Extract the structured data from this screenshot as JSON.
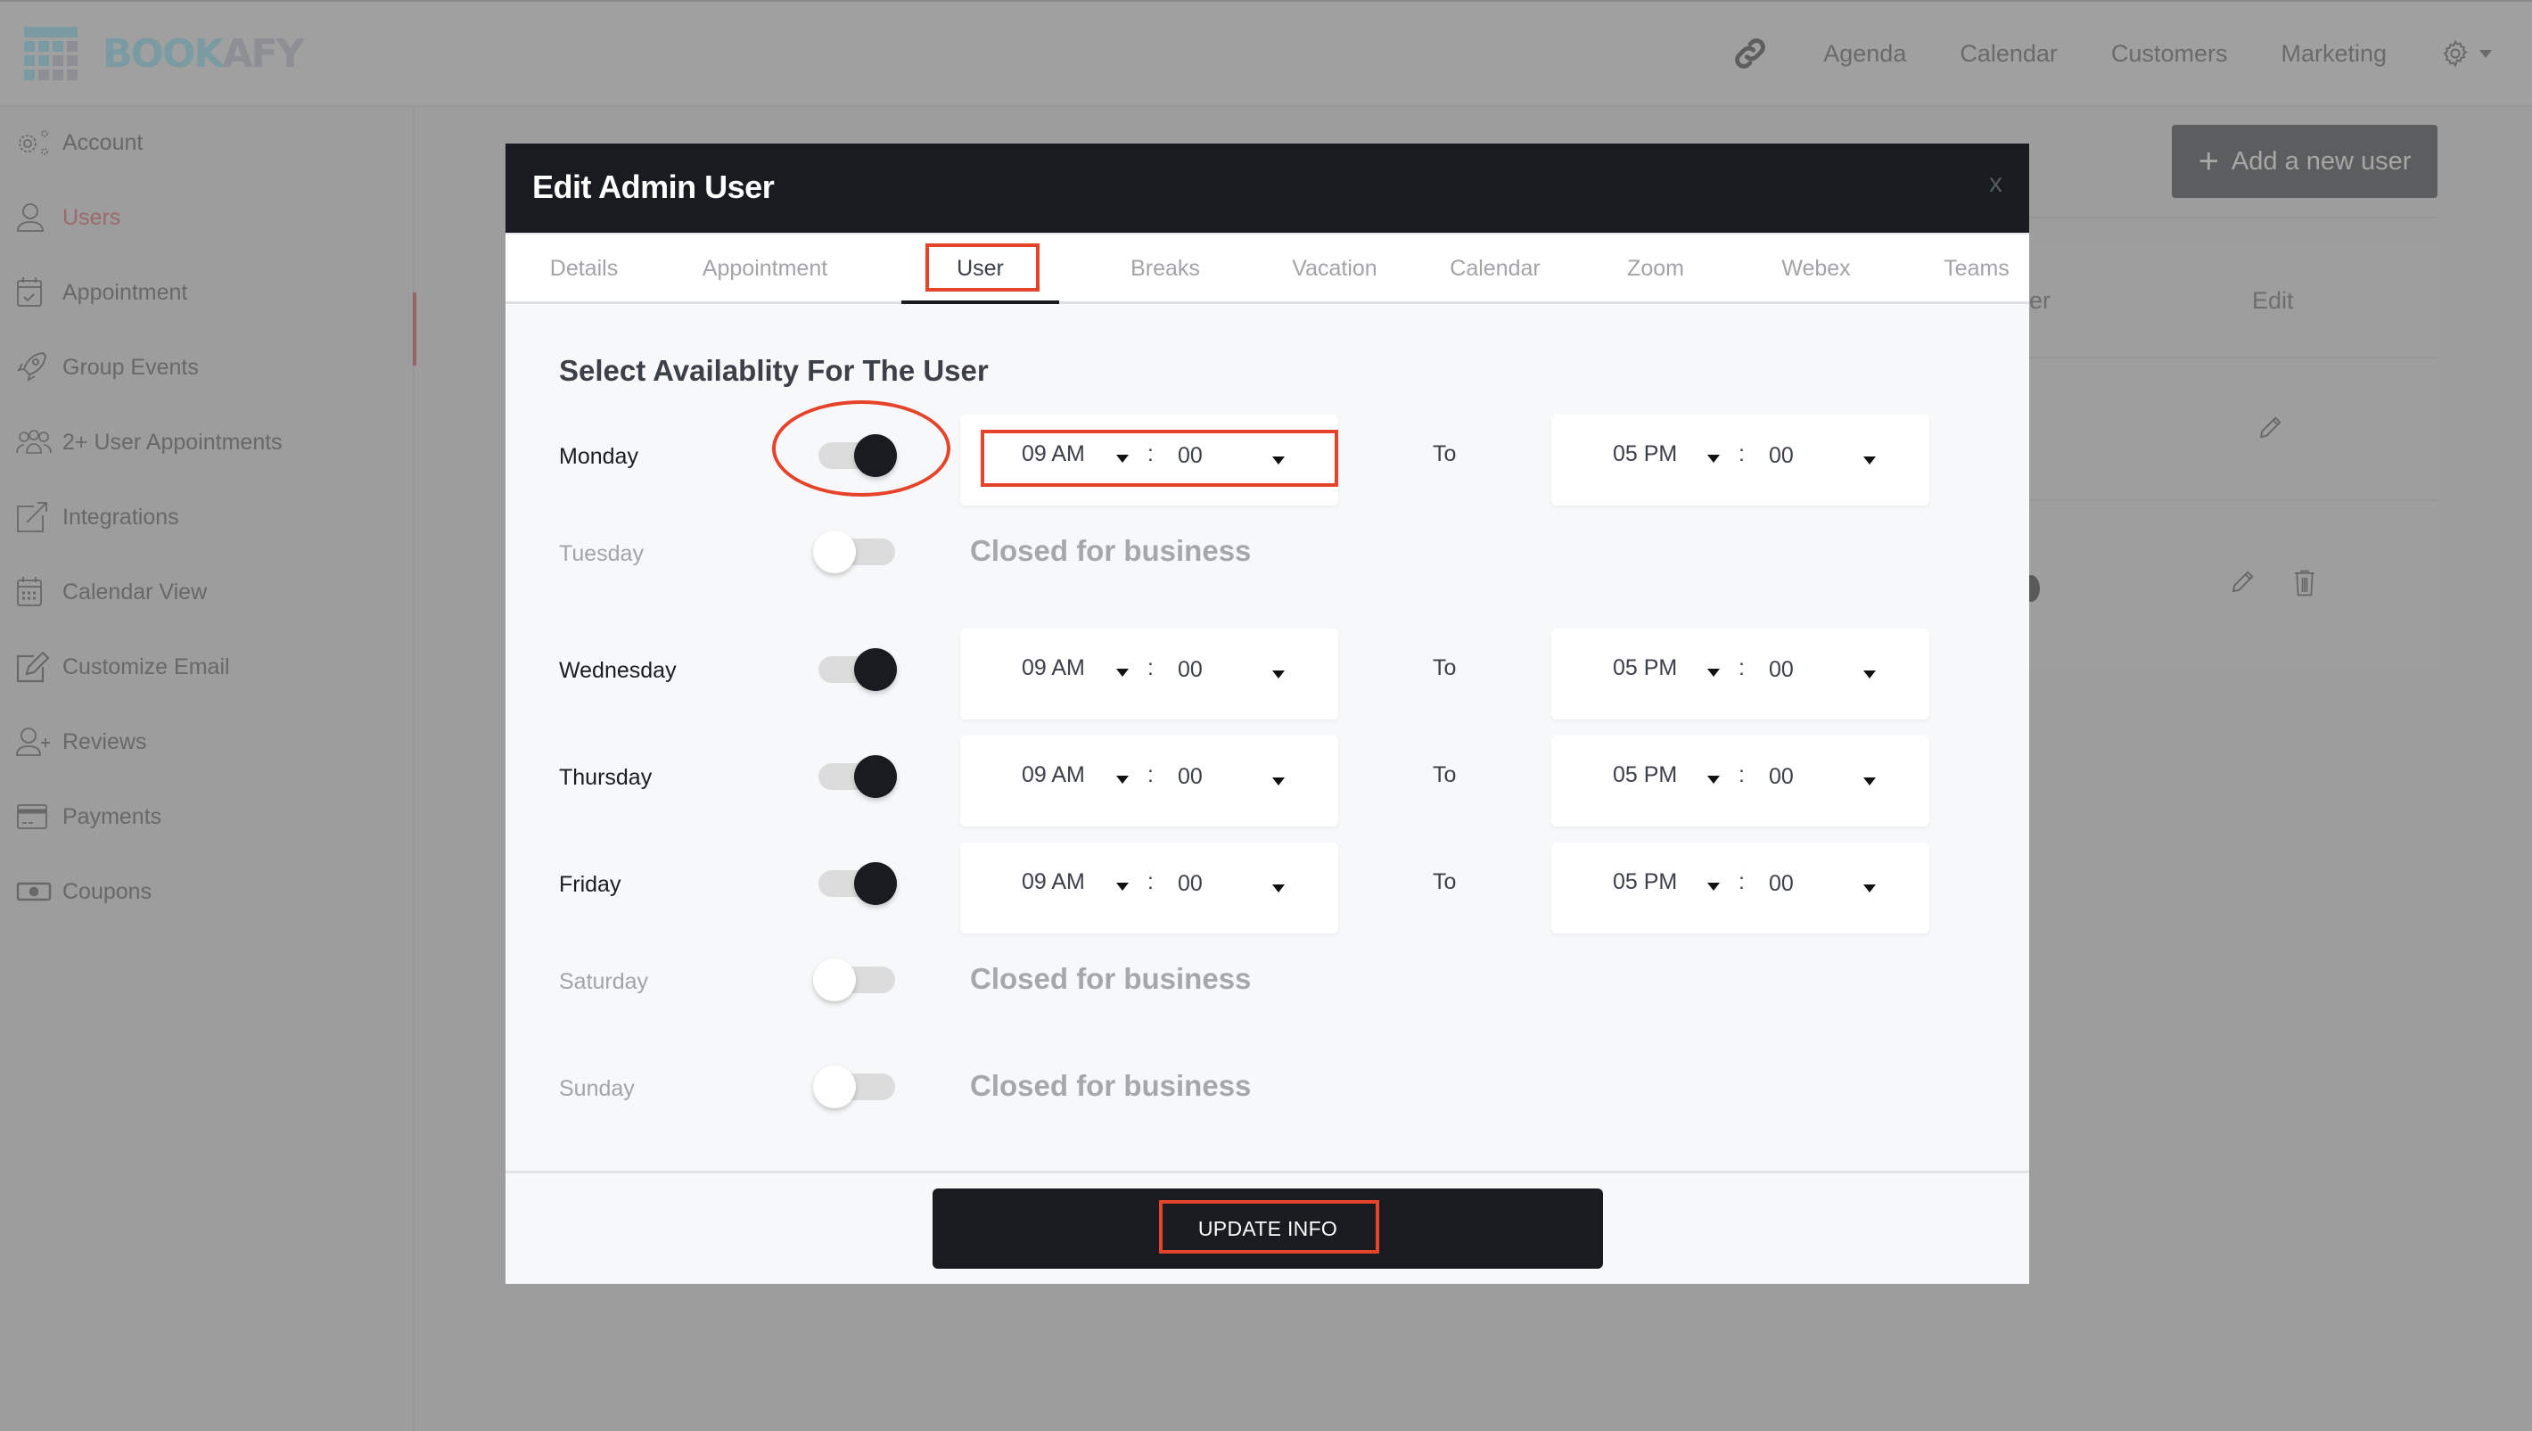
{
  "app": {
    "logo": {
      "part1": "BOOK",
      "part2": "AFY"
    }
  },
  "topnav": {
    "items": [
      {
        "label": "Agenda"
      },
      {
        "label": "Calendar"
      },
      {
        "label": "Customers"
      },
      {
        "label": "Marketing"
      }
    ],
    "link_icon": "link-icon",
    "settings_icon": "gear-icon"
  },
  "sidebar": {
    "active": "Users",
    "items": [
      {
        "label": "Account",
        "icon": "gears-icon"
      },
      {
        "label": "Users",
        "icon": "user-icon"
      },
      {
        "label": "Appointment",
        "icon": "calendar-check-icon"
      },
      {
        "label": "Group Events",
        "icon": "rocket-icon"
      },
      {
        "label": "2+ User Appointments",
        "icon": "users-group-icon"
      },
      {
        "label": "Integrations",
        "icon": "external-link-icon"
      },
      {
        "label": "Calendar View",
        "icon": "calendar-grid-icon"
      },
      {
        "label": "Customize Email",
        "icon": "edit-icon"
      },
      {
        "label": "Reviews",
        "icon": "user-plus-icon"
      },
      {
        "label": "Payments",
        "icon": "credit-card-icon"
      },
      {
        "label": "Coupons",
        "icon": "money-icon"
      }
    ]
  },
  "background": {
    "add_user_label": "Add a new user",
    "table_headers": [
      "er",
      "Edit"
    ]
  },
  "modal": {
    "title": "Edit Admin User",
    "close_label": "x",
    "active_tab": "User",
    "tabs": [
      {
        "label": "Details"
      },
      {
        "label": "Appointment"
      },
      {
        "label": "User"
      },
      {
        "label": "Breaks"
      },
      {
        "label": "Vacation"
      },
      {
        "label": "Calendar"
      },
      {
        "label": "Zoom"
      },
      {
        "label": "Webex"
      },
      {
        "label": "Teams"
      }
    ],
    "section_title": "Select Availablity For The User",
    "to_label": "To",
    "closed_label": "Closed for business",
    "days": [
      {
        "name": "Monday",
        "enabled": true,
        "from": {
          "hour": "09 AM",
          "minute": "00"
        },
        "to": {
          "hour": "05 PM",
          "minute": "00"
        }
      },
      {
        "name": "Tuesday",
        "enabled": false
      },
      {
        "name": "Wednesday",
        "enabled": true,
        "from": {
          "hour": "09 AM",
          "minute": "00"
        },
        "to": {
          "hour": "05 PM",
          "minute": "00"
        }
      },
      {
        "name": "Thursday",
        "enabled": true,
        "from": {
          "hour": "09 AM",
          "minute": "00"
        },
        "to": {
          "hour": "05 PM",
          "minute": "00"
        }
      },
      {
        "name": "Friday",
        "enabled": true,
        "from": {
          "hour": "09 AM",
          "minute": "00"
        },
        "to": {
          "hour": "05 PM",
          "minute": "00"
        }
      },
      {
        "name": "Saturday",
        "enabled": false
      },
      {
        "name": "Sunday",
        "enabled": false
      }
    ],
    "colon": ":",
    "update_label": "UPDATE INFO"
  },
  "colors": {
    "accent_dark": "#181b20",
    "annotation_red": "#e5432a",
    "sidebar_active": "#9a6a6e",
    "logo_teal": "#7a9ba1"
  }
}
